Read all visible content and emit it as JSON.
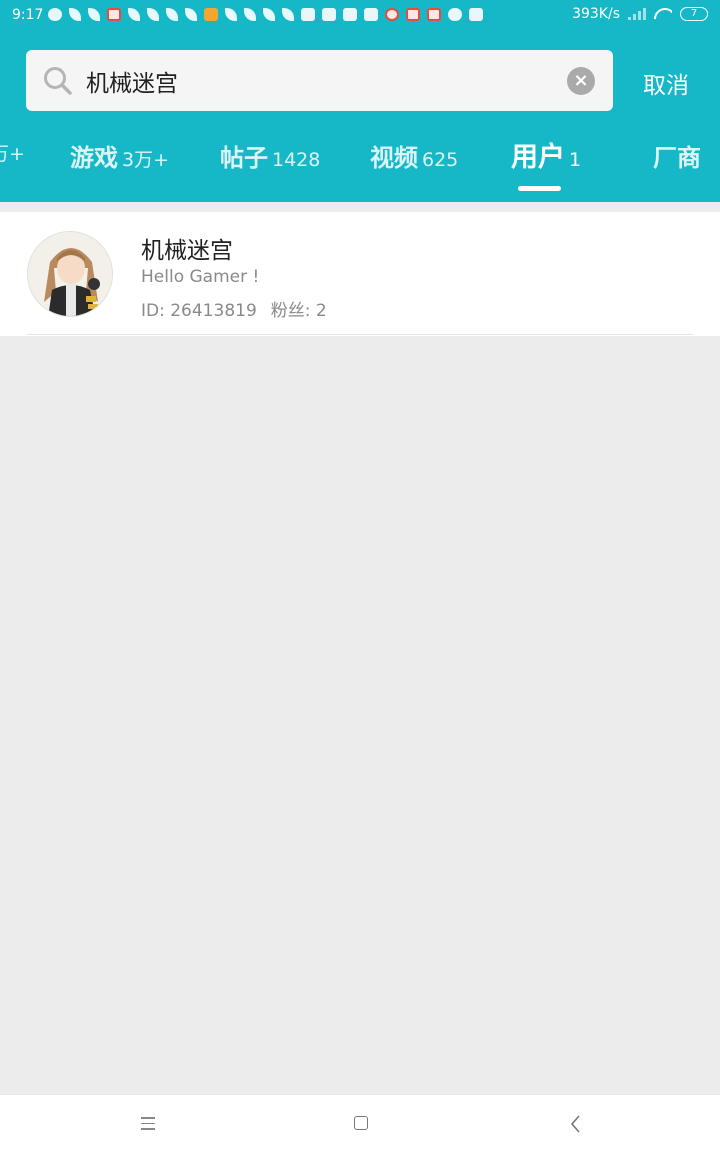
{
  "status_bar": {
    "time": "9:17",
    "net_speed": "393K/s",
    "battery": "7"
  },
  "search": {
    "query": "机械迷宫",
    "cancel_label": "取消"
  },
  "tabs": [
    {
      "label": "",
      "count": "万+",
      "active": false
    },
    {
      "label": "游戏",
      "count": "3万+",
      "active": false
    },
    {
      "label": "帖子",
      "count": "1428",
      "active": false
    },
    {
      "label": "视频",
      "count": "625",
      "active": false
    },
    {
      "label": "用户",
      "count": "1",
      "active": true
    },
    {
      "label": "厂商",
      "count": "",
      "active": false
    }
  ],
  "results": [
    {
      "name": "机械迷宫",
      "bio": "Hello Gamer !",
      "id_text": "ID: 26413819",
      "fans_text": "粉丝: 2"
    }
  ],
  "colors": {
    "accent": "#16b8c8",
    "background": "#ececec"
  }
}
